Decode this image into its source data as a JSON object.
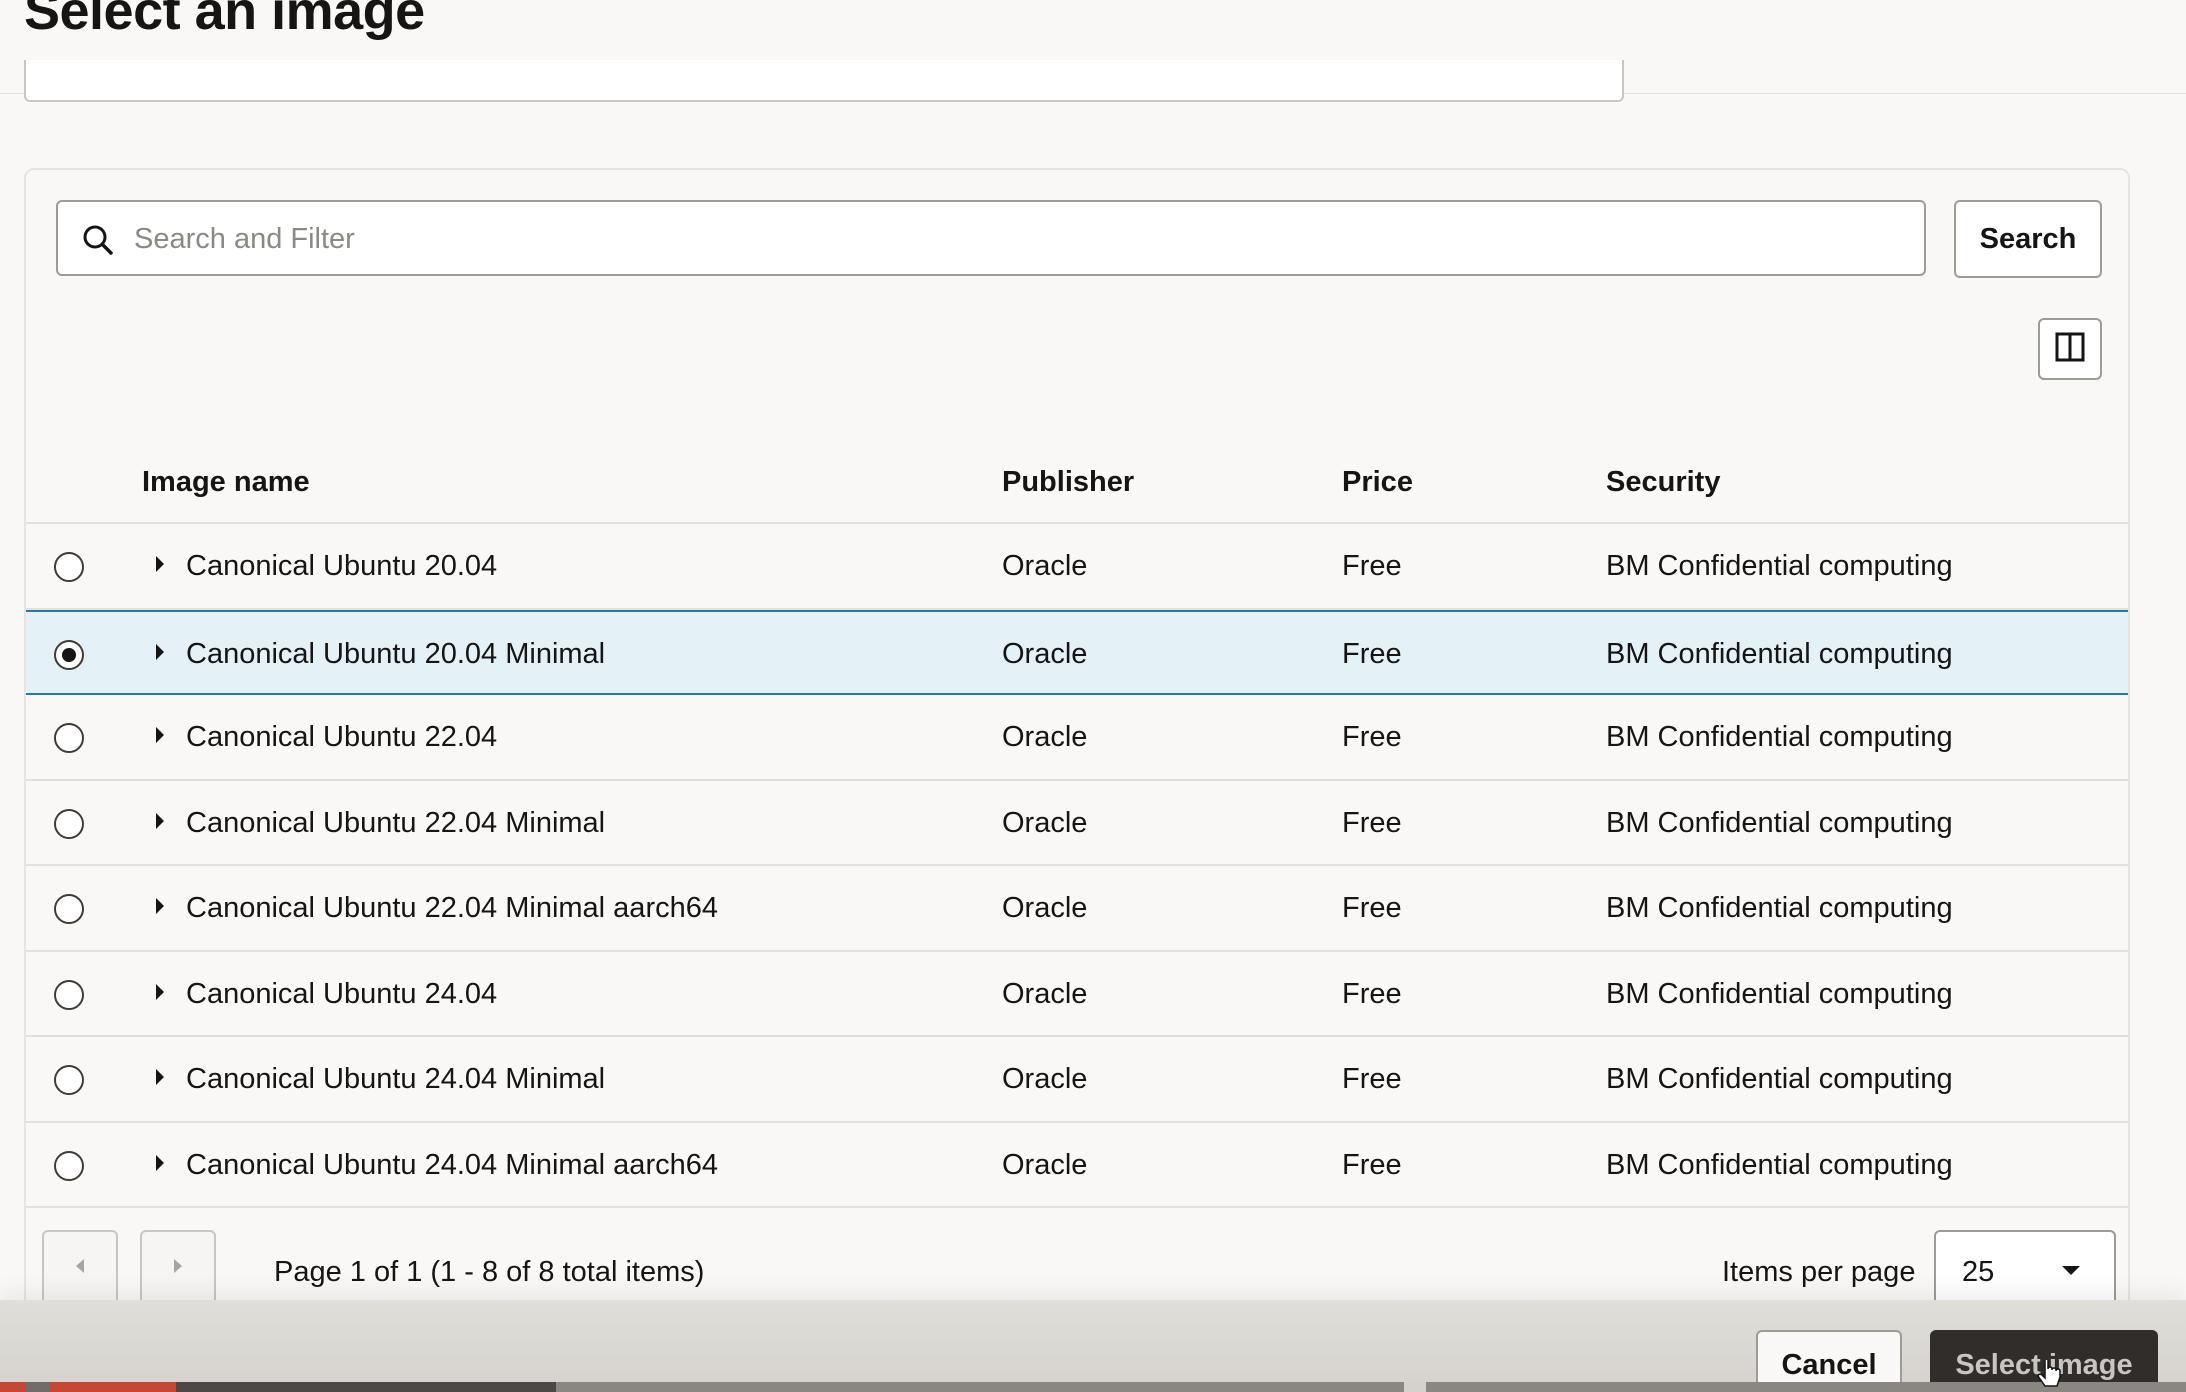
{
  "header": {
    "title": "Select an image"
  },
  "search": {
    "placeholder": "Search and Filter",
    "value": "",
    "button_label": "Search"
  },
  "table": {
    "columns": [
      "Image name",
      "Publisher",
      "Price",
      "Security"
    ],
    "rows": [
      {
        "name": "Canonical Ubuntu 20.04",
        "publisher": "Oracle",
        "price": "Free",
        "security": "BM Confidential computing",
        "selected": false
      },
      {
        "name": "Canonical Ubuntu 20.04 Minimal",
        "publisher": "Oracle",
        "price": "Free",
        "security": "BM Confidential computing",
        "selected": true
      },
      {
        "name": "Canonical Ubuntu 22.04",
        "publisher": "Oracle",
        "price": "Free",
        "security": "BM Confidential computing",
        "selected": false
      },
      {
        "name": "Canonical Ubuntu 22.04 Minimal",
        "publisher": "Oracle",
        "price": "Free",
        "security": "BM Confidential computing",
        "selected": false
      },
      {
        "name": "Canonical Ubuntu 22.04 Minimal aarch64",
        "publisher": "Oracle",
        "price": "Free",
        "security": "BM Confidential computing",
        "selected": false
      },
      {
        "name": "Canonical Ubuntu 24.04",
        "publisher": "Oracle",
        "price": "Free",
        "security": "BM Confidential computing",
        "selected": false
      },
      {
        "name": "Canonical Ubuntu 24.04 Minimal",
        "publisher": "Oracle",
        "price": "Free",
        "security": "BM Confidential computing",
        "selected": false
      },
      {
        "name": "Canonical Ubuntu 24.04 Minimal aarch64",
        "publisher": "Oracle",
        "price": "Free",
        "security": "BM Confidential computing",
        "selected": false
      }
    ]
  },
  "pagination": {
    "status": "Page 1 of 1 (1 - 8 of 8 total items)",
    "items_per_page_label": "Items per page",
    "items_per_page_value": "25"
  },
  "footer": {
    "cancel_label": "Cancel",
    "select_label": "Select image"
  },
  "icons": {
    "search": "search-icon",
    "columns": "columns-icon",
    "expand": "caret-right-icon",
    "prev": "caret-left-icon",
    "next": "caret-right-icon",
    "dropdown": "chevron-down-icon"
  },
  "colors": {
    "selected_row_bg": "#e4f1f7",
    "selected_row_border": "#227e9e",
    "primary_button": "#312d2a",
    "accent_red": "#c74634"
  }
}
